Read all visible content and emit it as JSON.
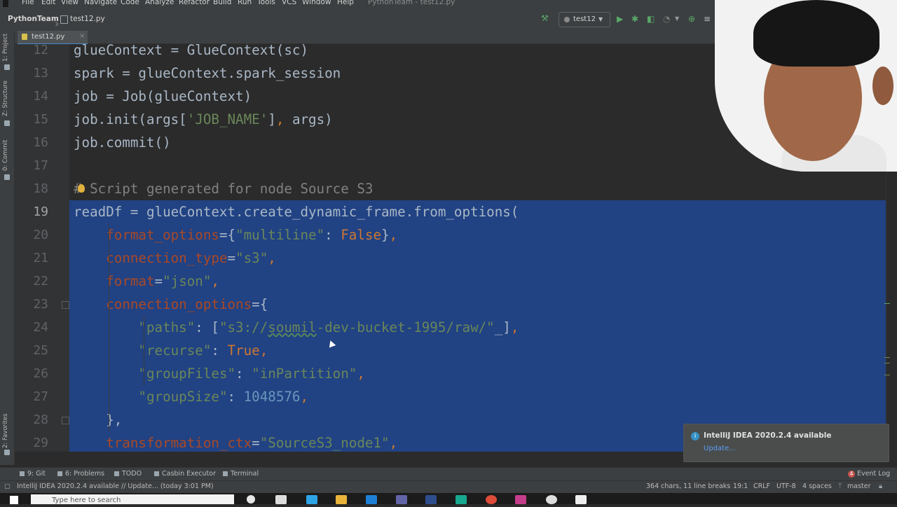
{
  "menu": {
    "items": [
      "File",
      "Edit",
      "View",
      "Navigate",
      "Code",
      "Analyze",
      "Refactor",
      "Build",
      "Run",
      "Tools",
      "VCS",
      "Window",
      "Help"
    ],
    "window_title": "PythonTeam - test12.py"
  },
  "nav": {
    "project": "PythonTeam",
    "file": "test12.py",
    "run_config": "test12"
  },
  "left_strip": [
    "1: Project",
    "Z: Structure",
    "0: Commit",
    "2: Favorites"
  ],
  "tab": {
    "label": "test12.py",
    "close": "×"
  },
  "editor": {
    "current_line": 19,
    "lines": [
      {
        "num": "12",
        "sel": false,
        "tokens": [
          [
            "",
            "glueContext = GlueContext(sc)"
          ]
        ]
      },
      {
        "num": "13",
        "sel": false,
        "tokens": [
          [
            "",
            "spark = glueContext.spark_session"
          ]
        ]
      },
      {
        "num": "14",
        "sel": false,
        "tokens": [
          [
            "",
            "job = Job(glueContext)"
          ]
        ]
      },
      {
        "num": "15",
        "sel": false,
        "tokens": [
          [
            "",
            "job.init(args["
          ],
          [
            "g",
            "'JOB_NAME'"
          ],
          [
            "",
            "]"
          ],
          [
            "o",
            ","
          ],
          [
            "",
            " args)"
          ]
        ]
      },
      {
        "num": "16",
        "sel": false,
        "tokens": [
          [
            "",
            "job.commit()"
          ]
        ]
      },
      {
        "num": "17",
        "sel": false,
        "tokens": []
      },
      {
        "num": "18",
        "sel": false,
        "tokens": [
          [
            "c",
            "# Script generated for node Source S3"
          ]
        ]
      },
      {
        "num": "19",
        "sel": true,
        "tokens": [
          [
            "",
            "readDf = glueContext.create_dynamic_frame.from_options("
          ]
        ]
      },
      {
        "num": "20",
        "sel": true,
        "tokens": [
          [
            "",
            "    "
          ],
          [
            "p",
            "format_options"
          ],
          [
            "",
            "={"
          ],
          [
            "g",
            "\"multiline\""
          ],
          [
            "",
            ": "
          ],
          [
            "o",
            "False"
          ],
          [
            "",
            "}"
          ],
          [
            "o",
            ","
          ]
        ]
      },
      {
        "num": "21",
        "sel": true,
        "tokens": [
          [
            "",
            "    "
          ],
          [
            "p",
            "connection_type"
          ],
          [
            "",
            "="
          ],
          [
            "g",
            "\"s3\""
          ],
          [
            "o",
            ","
          ]
        ]
      },
      {
        "num": "22",
        "sel": true,
        "tokens": [
          [
            "",
            "    "
          ],
          [
            "p",
            "format"
          ],
          [
            "",
            "="
          ],
          [
            "g",
            "\"json\""
          ],
          [
            "o",
            ","
          ]
        ]
      },
      {
        "num": "23",
        "sel": true,
        "tokens": [
          [
            "",
            "    "
          ],
          [
            "p",
            "connection_options"
          ],
          [
            "",
            "={"
          ]
        ]
      },
      {
        "num": "24",
        "sel": true,
        "tokens": [
          [
            "",
            "        "
          ],
          [
            "g",
            "\"paths\""
          ],
          [
            "",
            ": ["
          ],
          [
            "g",
            "\"s3://"
          ],
          [
            "gu",
            "soumil"
          ],
          [
            "g",
            "-dev-bucket-1995/raw/\""
          ],
          [
            "",
            "_"
          ],
          [
            "",
            "]"
          ],
          [
            "o",
            ","
          ]
        ]
      },
      {
        "num": "25",
        "sel": true,
        "tokens": [
          [
            "",
            "        "
          ],
          [
            "g",
            "\"recurse\""
          ],
          [
            "",
            ": "
          ],
          [
            "o",
            "True"
          ],
          [
            "o",
            ","
          ]
        ]
      },
      {
        "num": "26",
        "sel": true,
        "tokens": [
          [
            "",
            "        "
          ],
          [
            "g",
            "\"groupFiles\""
          ],
          [
            "",
            ": "
          ],
          [
            "g",
            "\"inPartition\""
          ],
          [
            "o",
            ","
          ]
        ]
      },
      {
        "num": "27",
        "sel": true,
        "tokens": [
          [
            "",
            "        "
          ],
          [
            "g",
            "\"groupSize\""
          ],
          [
            "",
            ": "
          ],
          [
            "b",
            "1048576"
          ],
          [
            "o",
            ","
          ]
        ]
      },
      {
        "num": "28",
        "sel": true,
        "tokens": [
          [
            "",
            "    },"
          ]
        ]
      },
      {
        "num": "29",
        "sel": true,
        "tokens": [
          [
            "",
            "    "
          ],
          [
            "p",
            "transformation_ctx"
          ],
          [
            "",
            "="
          ],
          [
            "g",
            "\"SourceS3_node1\""
          ],
          [
            "o",
            ","
          ]
        ]
      }
    ]
  },
  "notification": {
    "title": "IntelliJ IDEA 2020.2.4 available",
    "link": "Update..."
  },
  "tool_windows": {
    "git": "9: Git",
    "problems": "6: Problems",
    "todo": "TODO",
    "casbin": "Casbin Executor",
    "terminal": "Terminal",
    "event_count": "4",
    "event_log": "Event Log"
  },
  "status": {
    "message": "IntelliJ IDEA 2020.2.4 available // Update... (today 3:01 PM)",
    "chars": "364 chars, 11 line breaks",
    "position": "19:1",
    "line_sep": "CRLF",
    "encoding": "UTF-8",
    "indent": "4 spaces",
    "branch": "master"
  },
  "taskbar": {
    "search_placeholder": "Type here to search"
  },
  "colors": {
    "selection": "#214283",
    "keyword": "#cc7832",
    "string": "#6a8759",
    "number": "#6897bb",
    "comment": "#808080",
    "param": "#aa4926"
  }
}
